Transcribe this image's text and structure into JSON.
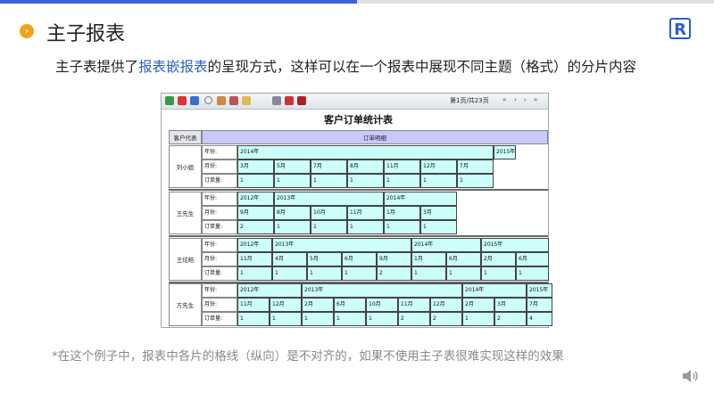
{
  "header": {
    "title": "主子报表",
    "bullet_glyph": "›",
    "logo_glyph": "R",
    "accent_color": "#3b5fd6"
  },
  "subtitle": {
    "before": "主子表提供了",
    "link": "报表嵌报表",
    "after": "的呈现方式，这样可以在一个报表中展现不同主题（格式）的分片内容"
  },
  "footnote": "*在这个例子中，报表中各片的格线（纵向）是不对齐的，如果不使用主子表很难实现这样的效果",
  "report": {
    "toolbar": {
      "pager": "第1页/共23页",
      "nav": [
        "«",
        "‹",
        "›",
        "»"
      ]
    },
    "title": "客户订单统计表",
    "col_customer": "客户代表",
    "col_detail": "订单明细",
    "row_labels": {
      "year": "年份:",
      "month": "月份:",
      "qty": "订单量:"
    },
    "customers": [
      {
        "name": "刘小姐",
        "year": [
          [
            "2014年",
            7
          ],
          [
            "2015年",
            1
          ]
        ],
        "months": [
          "3月",
          "5月",
          "7月",
          "8月",
          "11月",
          "12月",
          "7月"
        ],
        "qty": [
          "1",
          "1",
          "1",
          "1",
          "1",
          "1",
          "1"
        ]
      },
      {
        "name": "王先生",
        "year": [
          [
            "2012年",
            1
          ],
          [
            "2013年",
            3
          ],
          [
            "2014年",
            2
          ]
        ],
        "months": [
          "9月",
          "8月",
          "10月",
          "11月",
          "1月",
          "3月"
        ],
        "qty": [
          "2",
          "1",
          "1",
          "1",
          "1",
          "1"
        ]
      },
      {
        "name": "王炫皓",
        "year": [
          [
            "2012年",
            1
          ],
          [
            "2013年",
            4
          ],
          [
            "2014年",
            2
          ],
          [
            "2015年",
            2
          ]
        ],
        "months": [
          "11月",
          "4月",
          "5月",
          "6月",
          "9月",
          "1月",
          "6月",
          "2月",
          "6月"
        ],
        "qty": [
          "1",
          "1",
          "1",
          "1",
          "2",
          "1",
          "1",
          "1",
          "1"
        ]
      },
      {
        "name": "方先生",
        "year": [
          [
            "2012年",
            2
          ],
          [
            "2013年",
            5
          ],
          [
            "2014年",
            2
          ],
          [
            "2015年",
            1
          ]
        ],
        "months": [
          "11月",
          "12月",
          "2月",
          "6月",
          "10月",
          "11月",
          "12月",
          "2月",
          "3月",
          "7月"
        ],
        "qty": [
          "1",
          "1",
          "1",
          "1",
          "1",
          "2",
          "2",
          "1",
          "2",
          "4"
        ]
      }
    ]
  }
}
